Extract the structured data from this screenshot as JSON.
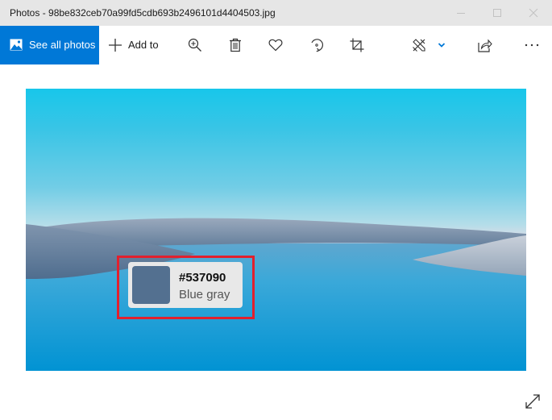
{
  "window": {
    "title": "Photos - 98be832ceb70a99fd5cdb693b2496101d4404503.jpg",
    "controls": [
      "minimize",
      "maximize",
      "close"
    ]
  },
  "toolbar": {
    "see_all_photos": {
      "label": "See all photos",
      "icon": "image-icon"
    },
    "add_to": {
      "label": "Add to",
      "icon": "plus-icon"
    },
    "actions": [
      {
        "name": "zoom",
        "icon": "zoom-in-icon"
      },
      {
        "name": "delete",
        "icon": "trash-icon"
      },
      {
        "name": "favorite",
        "icon": "heart-icon"
      },
      {
        "name": "rotate",
        "icon": "rotate-icon"
      },
      {
        "name": "crop",
        "icon": "crop-icon"
      },
      {
        "name": "edit-and-create",
        "icon": "edit-draw-icon"
      },
      {
        "name": "share",
        "icon": "share-icon"
      },
      {
        "name": "more",
        "icon": "more-icon"
      }
    ],
    "accent_color": "#0078d7"
  },
  "photo": {
    "description": "Lake with gray hills under a blue sky",
    "color_chip": {
      "hex": "#537090",
      "name": "Blue gray",
      "swatch_color": "#537090"
    },
    "highlight_color": "#e2202e"
  },
  "footer": {
    "expand_icon": "expand-icon"
  }
}
